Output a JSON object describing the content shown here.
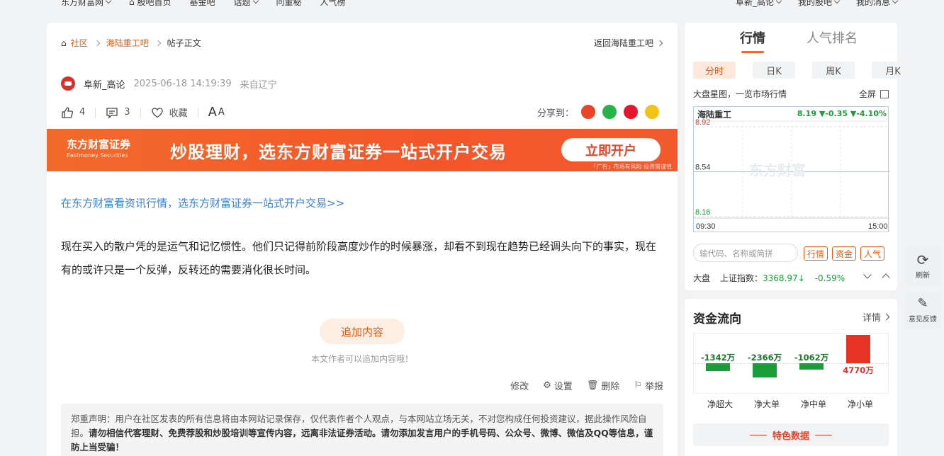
{
  "topnav": {
    "left": [
      "东方财富网",
      "股吧首页",
      "基金吧",
      "话题",
      "问董秘",
      "人气榜"
    ],
    "right": [
      "阜新_高论",
      "我的股吧",
      "我的消息"
    ]
  },
  "breadcrumb": {
    "home": "社区",
    "bar": "海陆重工吧",
    "current": "帖子正文"
  },
  "back_label": "返回海陆重工吧",
  "post": {
    "author": "阜新_高论",
    "time": "2025-06-18 14:19:39",
    "location": "来自辽宁",
    "likes": "4",
    "comments": "3",
    "fav_label": "收藏",
    "font_label": "A",
    "font_label_small": "A",
    "share_label": "分享到：",
    "ad_link": "在东方财富看资讯行情，选东方财富证券一站式开户交易>>",
    "content": "现在买入的散户凭的是运气和记忆惯性。他们只记得前阶段高度炒作的时候暴涨，却看不到现在趋势已经调头向下的事实，现在有的或许只是一个反弹，反转还的需要消化很长时间。",
    "add_button": "追加内容",
    "add_tip": "本文作者可以追加内容哦！",
    "ops": [
      "修改",
      "设置",
      "删除",
      "举报"
    ],
    "notice_prefix": "郑重声明：用户在社区发表的所有信息将由本网站记录保存，仅代表作者个人观点，与本网站立场无关，不对您构成任何投资建议，据此操作风险自担。",
    "notice_bold": "请勿相信代客理财、免费荐股和炒股培训等宣传内容，远离非法证券活动。请勿添加发言用户的手机号码、公众号、微博、微信及QQ等信息，谨防上当受骗！"
  },
  "banner": {
    "brand": "东方财富证券",
    "brand_en": "Eastmoney Securities",
    "slogan": "炒股理财，选东方财富证券一站式开户交易",
    "button": "立即开户",
    "tip": "「广告」市场有风险 投资需谨慎"
  },
  "quote": {
    "tabs": [
      "行情",
      "人气排名"
    ],
    "periods": [
      "分时",
      "日K",
      "周K",
      "月K"
    ],
    "market_label": "大盘星图，一览市场行情",
    "fullscreen": "全屏",
    "stock": "海陆重工",
    "change": "8.19 ▼-0.35 ▼-4.10%",
    "y_top": "8.92",
    "y_mid": "8.54",
    "y_bottom": "8.16",
    "t_start": "09:30",
    "t_end": "15:00",
    "watermark": "东方财富",
    "search_placeholder": "输代码、名称或简拼",
    "buttons": [
      "行情",
      "资金",
      "人气"
    ],
    "index_label": "大盘",
    "index_name": "上证指数：",
    "index_value": "3368.97↓",
    "index_change": "-0.59%"
  },
  "flow": {
    "title": "资金流向",
    "more": "详情",
    "categories": [
      "净超大",
      "净大单",
      "净中单",
      "净小单"
    ],
    "values": [
      "-1342万",
      "-2366万",
      "-1062万",
      "4770万"
    ],
    "special": "特色数据"
  },
  "side": {
    "refresh": "刷新",
    "feedback": "意见反馈"
  },
  "chart_data": {
    "type": "line",
    "title": "海陆重工",
    "x": [
      "09:30",
      "15:00"
    ],
    "ylim": [
      8.16,
      8.92
    ],
    "reference": 8.54,
    "series": [],
    "colors": {
      "price": "#2257c6",
      "avg": "#f0b43c",
      "down": "#1a9e3a",
      "up": "#e53425"
    }
  }
}
